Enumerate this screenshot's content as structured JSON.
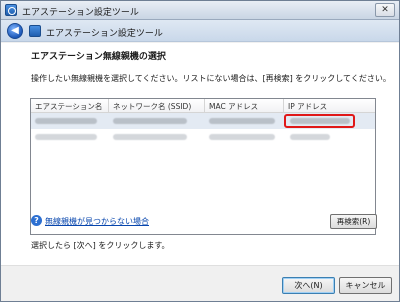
{
  "window": {
    "title": "エアステーション設定ツール",
    "close_label": "✕"
  },
  "header": {
    "back_label": "◀",
    "title": "エアステーション設定ツール"
  },
  "main": {
    "section_title": "エアステーション無線親機の選択",
    "instruction": "操作したい無線親機を選択してください。リストにない場合は、[再検索] をクリックしてください。",
    "columns": [
      "エアステーション名",
      "ネットワーク名 (SSID)",
      "MAC アドレス",
      "IP アドレス"
    ],
    "help_icon": "?",
    "help_link": "無線親機が見つからない場合",
    "research_button": "再検索(R)",
    "footer_hint": "選択したら [次へ] をクリックします。"
  },
  "buttons": {
    "next": "次へ(N)",
    "cancel": "キャンセル"
  },
  "colors": {
    "highlight": "#e01818",
    "selected_row": "#e3eaf3",
    "link": "#0645ad"
  }
}
